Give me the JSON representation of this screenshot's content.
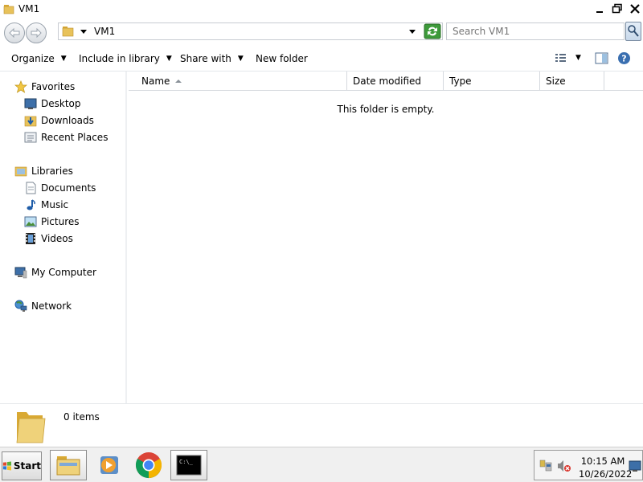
{
  "window": {
    "title": "VM1"
  },
  "address": {
    "path": "VM1"
  },
  "search": {
    "placeholder": "Search VM1"
  },
  "toolbar": {
    "organize": "Organize",
    "include_in_library": "Include in library",
    "share_with": "Share with",
    "new_folder": "New folder"
  },
  "nav": {
    "favorites": "Favorites",
    "desktop": "Desktop",
    "downloads": "Downloads",
    "recent_places": "Recent Places",
    "libraries": "Libraries",
    "documents": "Documents",
    "music": "Music",
    "pictures": "Pictures",
    "videos": "Videos",
    "my_computer": "My Computer",
    "network": "Network"
  },
  "columns": {
    "name": "Name",
    "date_modified": "Date modified",
    "type": "Type",
    "size": "Size"
  },
  "content": {
    "empty_message": "This folder is empty."
  },
  "details": {
    "item_count": "0 items"
  },
  "taskbar": {
    "start_label": "Start",
    "clock_time": "10:15 AM",
    "clock_date": "10/26/2022",
    "console_glyph": "C:\\_"
  },
  "colors": {
    "accent": "#3a6fb0",
    "folder_yellow": "#e8c25a",
    "taskbar_bg": "#f0f0f0"
  },
  "icons": [
    "folder-icon",
    "back-arrow-icon",
    "forward-arrow-icon",
    "refresh-icon",
    "search-icon",
    "view-options-icon",
    "preview-pane-icon",
    "help-icon",
    "star-icon",
    "desktop-icon",
    "downloads-icon",
    "recent-places-icon",
    "libraries-icon",
    "documents-icon",
    "music-icon",
    "pictures-icon",
    "videos-icon",
    "computer-icon",
    "network-icon",
    "windows-flag-icon",
    "media-player-icon",
    "chrome-icon",
    "console-icon",
    "network-tray-icon",
    "volume-muted-icon",
    "show-desktop-icon"
  ]
}
